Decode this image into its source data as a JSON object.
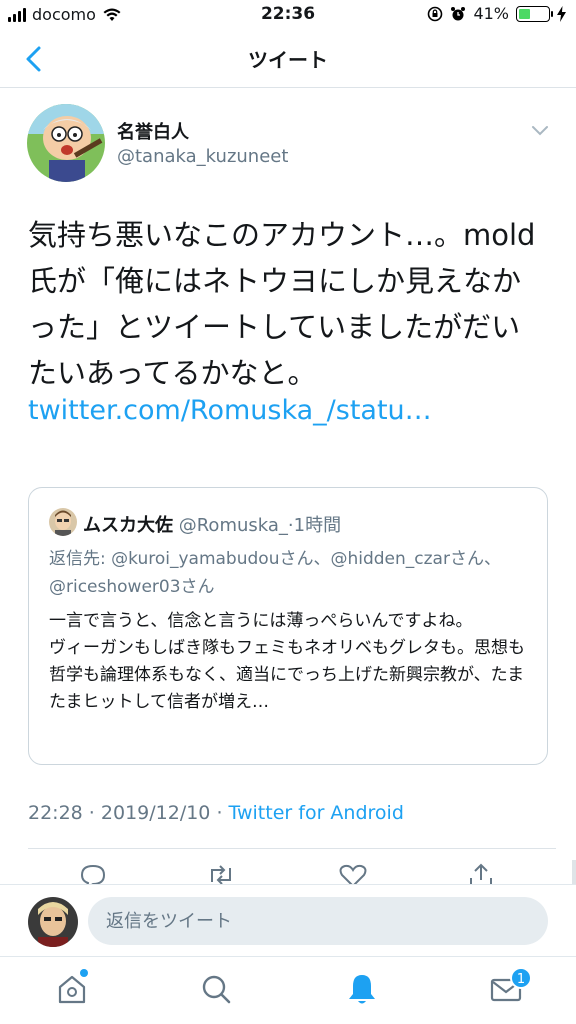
{
  "status_bar": {
    "carrier": "docomo",
    "time": "22:36",
    "battery": "41%",
    "battery_level": 0.41,
    "icons": [
      "signal-icon",
      "wifi-icon",
      "orientation-lock-icon",
      "alarm-icon",
      "battery-icon",
      "charging-icon"
    ]
  },
  "header": {
    "title": "ツイート",
    "back_icon": "chevron-left-icon"
  },
  "tweet": {
    "author_name": "名誉白人",
    "author_handle": "@tanaka_kuzuneet",
    "text": "気持ち悪いなこのアカウント…。mold氏が「俺にはネトウヨにしか見えなかった」とツイートしていましたがだいたいあってるかなと。",
    "link": "twitter.com/Romuska_/statu…",
    "time": "22:28",
    "date": "2019/12/10",
    "source": "Twitter for Android"
  },
  "quoted": {
    "name": "ムスカ大佐",
    "handle": "@Romuska_",
    "relative_time": "1時間",
    "reply_prefix": "返信先: ",
    "reply_mentions": "@kuroi_yamabudouさん、@hidden_czarさん、@riceshower03さん",
    "text": "一言で言うと、信念と言うには薄っぺらいんですよね。\nヴィーガンもしばき隊もフェミもネオリベもグレタも。思想も哲学も論理体系もなく、適当にでっち上げた新興宗教が、たまたまヒットして信者が増え…"
  },
  "reply_bar": {
    "placeholder": "返信をツイート"
  },
  "tab_bar": {
    "items": [
      "home-icon",
      "search-icon",
      "notifications-icon",
      "messages-icon"
    ],
    "messages_badge": "1"
  },
  "colors": {
    "accent": "#1da1f2",
    "secondary_text": "#657786",
    "border": "#ccd6dd"
  }
}
